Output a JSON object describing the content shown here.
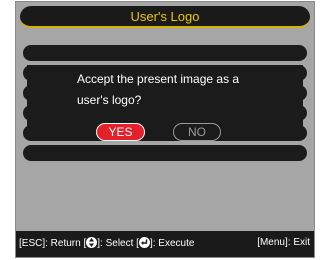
{
  "window": {
    "title": "User's Logo"
  },
  "dialog": {
    "message_line1": "Accept the present image as a",
    "message_line2": "user's logo?",
    "yes_label": "YES",
    "no_label": "NO"
  },
  "footer": {
    "esc_text": "[ESC]: Return [",
    "select_text": "]: Select [",
    "execute_text": "]: Execute",
    "menu_text": "[Menu]: Exit",
    "icons": [
      "updown-arrows-icon",
      "enter-icon"
    ]
  },
  "colors": {
    "title_text": "#f0c800",
    "title_underline": "#d6b400",
    "yes_button": "#e4202a",
    "panel": "#1b1b1b",
    "screen_bg": "#a6a6a6"
  }
}
